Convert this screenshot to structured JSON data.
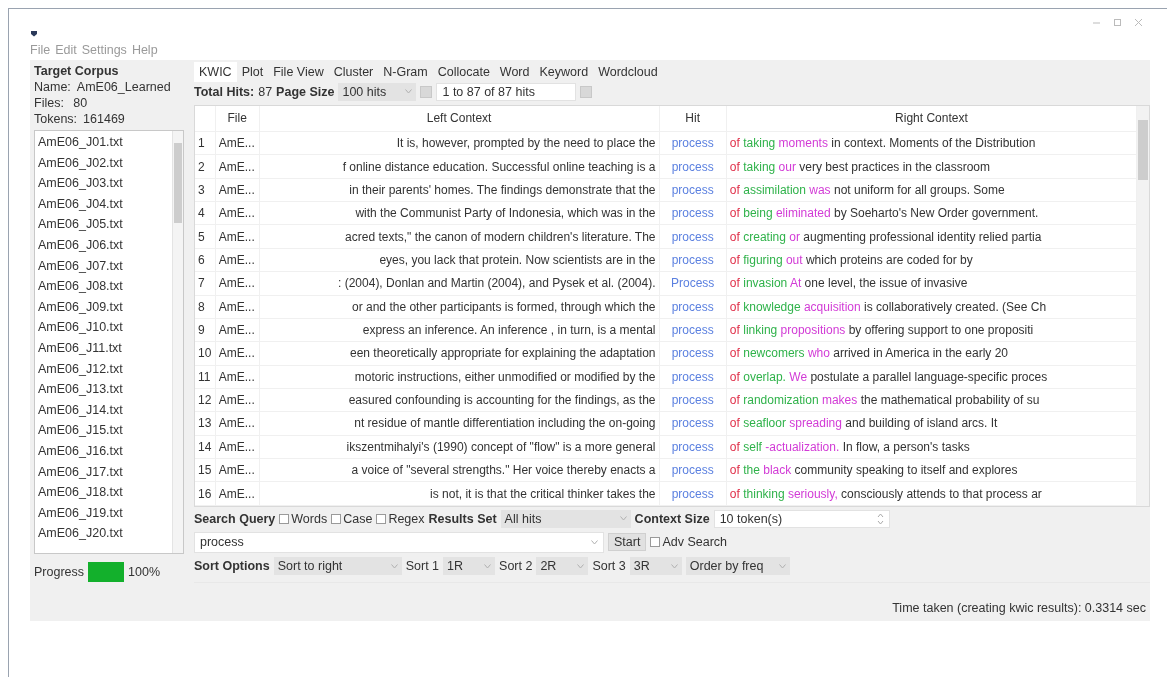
{
  "menu": [
    "File",
    "Edit",
    "Settings",
    "Help"
  ],
  "corpus": {
    "title": "Target Corpus",
    "name_label": "Name:",
    "name": "AmE06_Learned",
    "files_label": "Files:",
    "files": "80",
    "tokens_label": "Tokens:",
    "tokens": "161469"
  },
  "files": [
    "AmE06_J01.txt",
    "AmE06_J02.txt",
    "AmE06_J03.txt",
    "AmE06_J04.txt",
    "AmE06_J05.txt",
    "AmE06_J06.txt",
    "AmE06_J07.txt",
    "AmE06_J08.txt",
    "AmE06_J09.txt",
    "AmE06_J10.txt",
    "AmE06_J11.txt",
    "AmE06_J12.txt",
    "AmE06_J13.txt",
    "AmE06_J14.txt",
    "AmE06_J15.txt",
    "AmE06_J16.txt",
    "AmE06_J17.txt",
    "AmE06_J18.txt",
    "AmE06_J19.txt",
    "AmE06_J20.txt"
  ],
  "progress": {
    "label": "Progress",
    "level": 1,
    "reading": "100%"
  },
  "tabs": [
    {
      "label": "KWIC",
      "selected": true
    },
    {
      "label": "Plot",
      "selected": false
    },
    {
      "label": "File View",
      "selected": false
    },
    {
      "label": "Cluster",
      "selected": false
    },
    {
      "label": "N-Gram",
      "selected": false
    },
    {
      "label": "Collocate",
      "selected": false
    },
    {
      "label": "Word",
      "selected": false
    },
    {
      "label": "Keyword",
      "selected": false
    },
    {
      "label": "Wordcloud",
      "selected": false
    }
  ],
  "toolbar": {
    "total_hits_label": "Total Hits:",
    "total_hits": "87",
    "page_size_label": "Page Size",
    "page_size": "100 hits",
    "page_range": "1 to 87 of 87 hits"
  },
  "table": {
    "columns": [
      "File",
      "Left Context",
      "Hit",
      "Right Context"
    ],
    "rows": [
      {
        "n": "1",
        "file": "AmE...",
        "left": "It is, however, prompted by the need to place the",
        "hit": "process",
        "r1": "of",
        "r2": "taking",
        "r3": "moments",
        "rest": "in context. Moments of the Distribution"
      },
      {
        "n": "2",
        "file": "AmE...",
        "left": "f online distance education. Successful online teaching is a",
        "hit": "process",
        "r1": "of",
        "r2": "taking",
        "r3": "our",
        "rest": "very best practices in the classroom"
      },
      {
        "n": "3",
        "file": "AmE...",
        "left": "in their parents' homes. The findings demonstrate that the",
        "hit": "process",
        "r1": "of",
        "r2": "assimilation",
        "r3": "was",
        "rest": "not uniform for all groups. Some"
      },
      {
        "n": "4",
        "file": "AmE...",
        "left": "with the Communist Party of Indonesia, which was in the",
        "hit": "process",
        "r1": "of",
        "r2": "being",
        "r3": "eliminated",
        "rest": "by Soeharto's New Order government."
      },
      {
        "n": "5",
        "file": "AmE...",
        "left": "acred texts,\" the canon of modern children's literature. The",
        "hit": "process",
        "r1": "of",
        "r2": "creating",
        "r3": "or",
        "rest": "augmenting professional identity relied partia"
      },
      {
        "n": "6",
        "file": "AmE...",
        "left": "eyes, you lack that protein. Now scientists are in the",
        "hit": "process",
        "r1": "of",
        "r2": "figuring",
        "r3": "out",
        "rest": "which proteins are coded for by"
      },
      {
        "n": "7",
        "file": "AmE...",
        "left": ": (2004), Donlan and Martin (2004), and Pysek et al. (2004).",
        "hit": "Process",
        "r1": "of",
        "r2": "invasion",
        "r3": "At",
        "rest": "one level, the issue of invasive"
      },
      {
        "n": "8",
        "file": "AmE...",
        "left": "or and the other participants is formed, through which the",
        "hit": "process",
        "r1": "of",
        "r2": "knowledge",
        "r3": "acquisition",
        "rest": "is collaboratively created. (See Ch"
      },
      {
        "n": "9",
        "file": "AmE...",
        "left": "express an inference. An inference , in turn, is a mental",
        "hit": "process",
        "r1": "of",
        "r2": "linking",
        "r3": "propositions",
        "rest": "by offering support to one propositi"
      },
      {
        "n": "10",
        "file": "AmE...",
        "left": "een theoretically appropriate for explaining the adaptation",
        "hit": "process",
        "r1": "of",
        "r2": "newcomers",
        "r3": "who",
        "rest": "arrived in America in the early 20"
      },
      {
        "n": "11",
        "file": "AmE...",
        "left": "motoric instructions, either unmodified or modified by the",
        "hit": "process",
        "r1": "of",
        "r2": "overlap.",
        "r3": "We",
        "rest": "postulate a parallel language-specific proces"
      },
      {
        "n": "12",
        "file": "AmE...",
        "left": "easured confounding is accounting for the findings, as the",
        "hit": "process",
        "r1": "of",
        "r2": "randomization",
        "r3": "makes",
        "rest": "the mathematical probability of su"
      },
      {
        "n": "13",
        "file": "AmE...",
        "left": "nt residue of mantle differentiation including the on-going",
        "hit": "process",
        "r1": "of",
        "r2": "seafloor",
        "r3": "spreading",
        "rest": "and building of island arcs. It"
      },
      {
        "n": "14",
        "file": "AmE...",
        "left": "ikszentmihalyi's (1990) concept of \"flow\" is a more general",
        "hit": "process",
        "r1": "of",
        "r2": "self",
        "r3": "-actualization.",
        "rest": "In flow, a person's tasks"
      },
      {
        "n": "15",
        "file": "AmE...",
        "left": "a voice of \"several strengths.\" Her voice thereby enacts a",
        "hit": "process",
        "r1": "of",
        "r2": "the",
        "r3": "black",
        "rest": "community speaking to itself and explores"
      },
      {
        "n": "16",
        "file": "AmE...",
        "left": "is not, it is that the critical thinker takes the",
        "hit": "process",
        "r1": "of",
        "r2": "thinking",
        "r3": "seriously,",
        "rest": "consciously attends to that process ar"
      }
    ]
  },
  "search": {
    "label": "Search Query",
    "options": [
      {
        "label": "Words",
        "checked": false
      },
      {
        "label": "Case",
        "checked": false
      },
      {
        "label": "Regex",
        "checked": false
      }
    ],
    "results_set_label": "Results Set",
    "results_set": "All hits",
    "context_size_label": "Context Size",
    "context_size": "10 token(s)",
    "query": "process",
    "start": "Start",
    "adv_search": {
      "label": "Adv Search",
      "checked": false
    }
  },
  "sort": {
    "label": "Sort Options",
    "mode": "Sort to right",
    "sorts": [
      {
        "label": "Sort 1",
        "value": "1R"
      },
      {
        "label": "Sort 2",
        "value": "2R"
      },
      {
        "label": "Sort 3",
        "value": "3R"
      }
    ],
    "order": "Order by freq"
  },
  "status": "Time taken (creating kwic results):  0.3314 sec"
}
